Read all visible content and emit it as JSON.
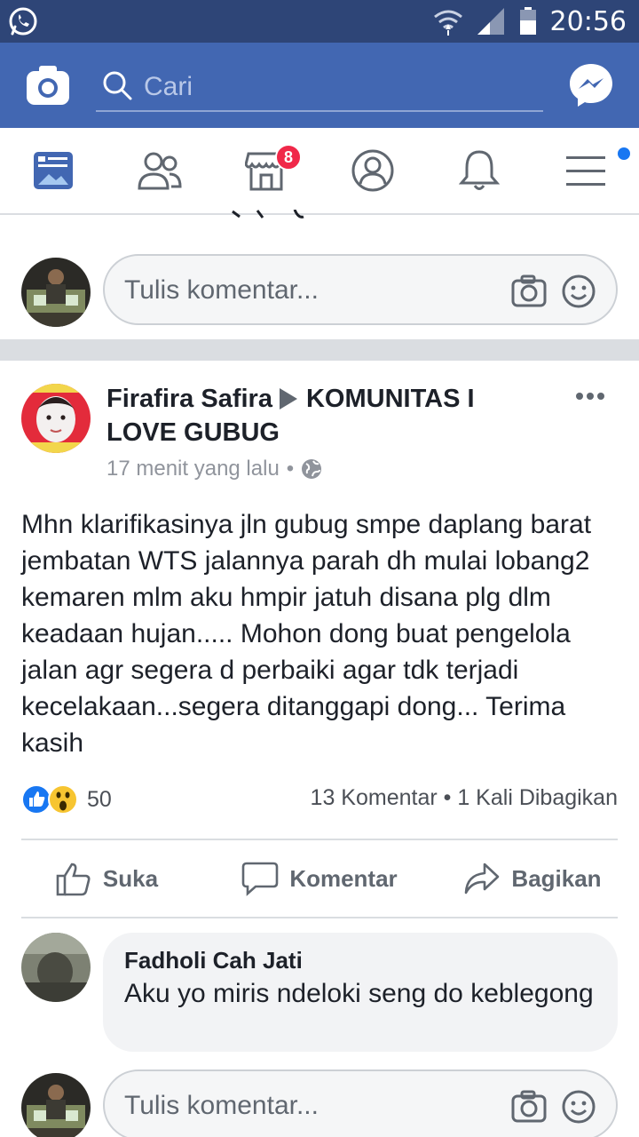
{
  "status_bar": {
    "time": "20:56"
  },
  "search": {
    "placeholder": "Cari"
  },
  "nav": {
    "marketplace_badge": "8"
  },
  "composer": {
    "placeholder": "Tulis komentar..."
  },
  "post": {
    "author": "Firafira Safira",
    "group": "KOMUNITAS I LOVE GUBUG",
    "time": "17 menit yang lalu",
    "privacy_icon": "globe-icon",
    "body": "Mhn klarifikasinya jln gubug smpe daplang barat jembatan WTS jalannya parah dh mulai lobang2 kemaren mlm aku hmpir jatuh disana plg dlm keadaan hujan..... Mohon dong buat pengelola jalan agr segera d perbaiki agar tdk terjadi kecelakaan...segera ditanggapi dong... Terima kasih",
    "reaction_count": "50",
    "comments_shares": "13 Komentar • 1 Kali Dibagikan"
  },
  "actions": {
    "like": "Suka",
    "comment": "Komentar",
    "share": "Bagikan"
  },
  "comment": {
    "author": "Fadholi Cah Jati",
    "text": "Aku yo miris ndeloki seng do keblegong"
  },
  "colors": {
    "fb_blue": "#4267b2",
    "status_bar": "#2e4577",
    "badge_red": "#f02849"
  }
}
